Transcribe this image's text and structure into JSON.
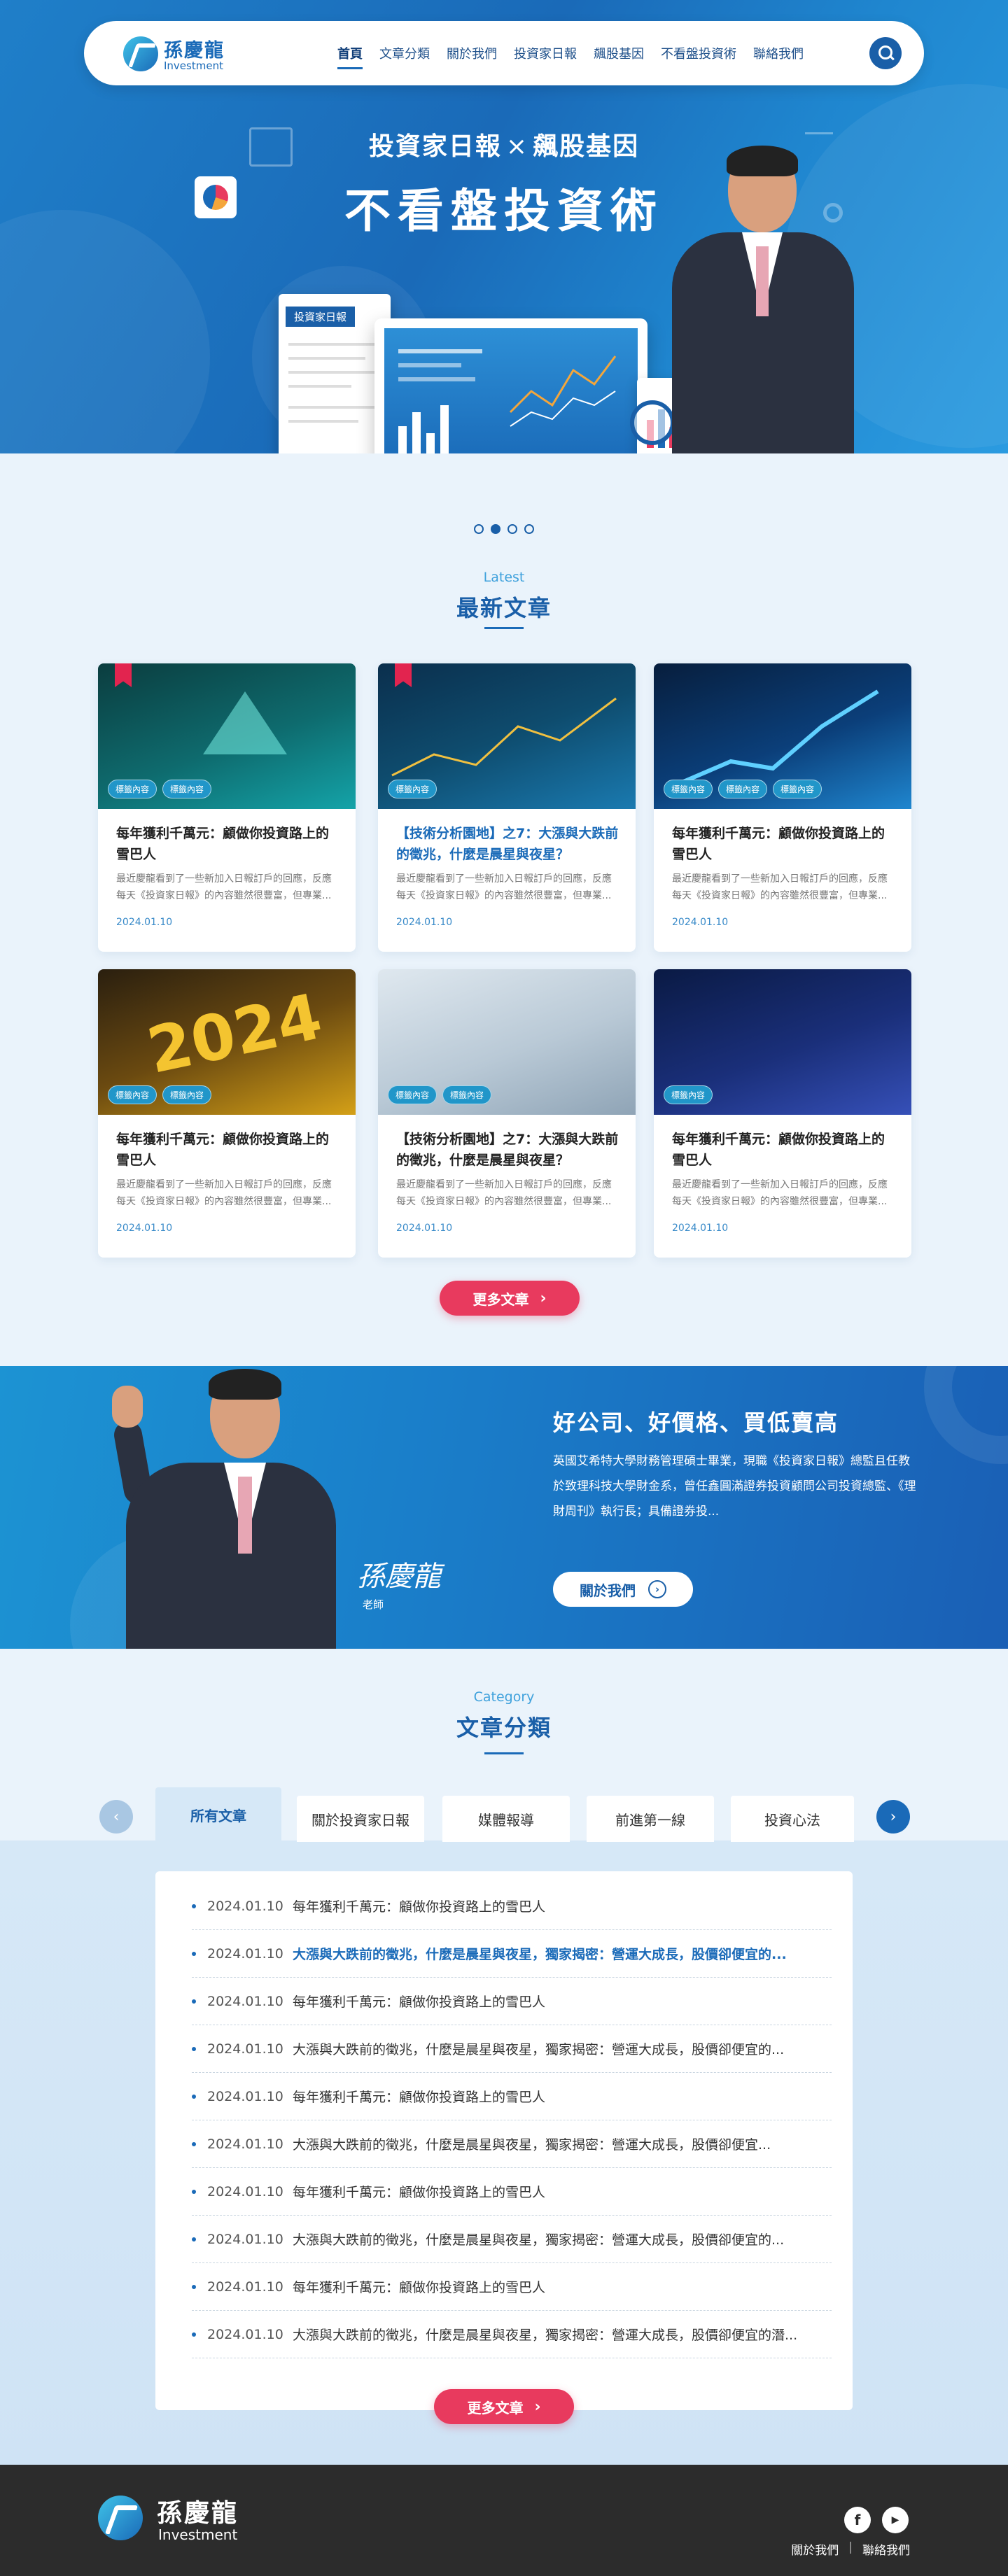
{
  "brand": {
    "name_cn": "孫慶龍",
    "name_en": "Investment"
  },
  "nav": {
    "items": [
      "首頁",
      "文章分類",
      "關於我們",
      "投資家日報",
      "飆股基因",
      "不看盤投資術",
      "聯絡我們"
    ],
    "active": 0
  },
  "hero": {
    "subtitle_left": "投資家日報",
    "subtitle_x": "×",
    "subtitle_right": "飆股基因",
    "title": "不看盤投資術",
    "report_label": "投資家日報",
    "slides": 4,
    "active_slide": 1
  },
  "latest": {
    "en": "Latest",
    "cn": "最新文章",
    "cards": [
      {
        "title": "每年獲利千萬元：顧做你投資路上的雪巴人",
        "desc": "最近慶龍看到了一些新加入日報訂戶的回應，反應每天《投資家日報》的內容雖然很豐富，但專業...",
        "date": "2024.01.10",
        "tags": [
          "標籤內容",
          "標籤內容"
        ],
        "bookmark": true,
        "highlight": false
      },
      {
        "title": "【技術分析園地】之7：大漲與大跌前的徵兆，什麼是晨星與夜星？",
        "desc": "最近慶龍看到了一些新加入日報訂戶的回應，反應每天《投資家日報》的內容雖然很豐富，但專業...",
        "date": "2024.01.10",
        "tags": [
          "標籤內容"
        ],
        "bookmark": true,
        "highlight": true
      },
      {
        "title": "每年獲利千萬元：顧做你投資路上的雪巴人",
        "desc": "最近慶龍看到了一些新加入日報訂戶的回應，反應每天《投資家日報》的內容雖然很豐富，但專業...",
        "date": "2024.01.10",
        "tags": [
          "標籤內容",
          "標籤內容",
          "標籤內容"
        ],
        "bookmark": false,
        "highlight": false
      },
      {
        "title": "每年獲利千萬元：顧做你投資路上的雪巴人",
        "desc": "最近慶龍看到了一些新加入日報訂戶的回應，反應每天《投資家日報》的內容雖然很豐富，但專業...",
        "date": "2024.01.10",
        "tags": [
          "標籤內容",
          "標籤內容"
        ],
        "bookmark": false,
        "highlight": false
      },
      {
        "title": "【技術分析園地】之7：大漲與大跌前的徵兆，什麼是晨星與夜星？",
        "desc": "最近慶龍看到了一些新加入日報訂戶的回應，反應每天《投資家日報》的內容雖然很豐富，但專業...",
        "date": "2024.01.10",
        "tags": [
          "標籤內容",
          "標籤內容"
        ],
        "bookmark": false,
        "highlight": false
      },
      {
        "title": "每年獲利千萬元：顧做你投資路上的雪巴人",
        "desc": "最近慶龍看到了一些新加入日報訂戶的回應，反應每天《投資家日報》的內容雖然很豐富，但專業...",
        "date": "2024.01.10",
        "tags": [
          "標籤內容"
        ],
        "bookmark": false,
        "highlight": false
      }
    ],
    "more": "更多文章"
  },
  "about": {
    "title": "好公司、好價格、買低賣高",
    "desc": "英國艾希特大學財務管理碩士畢業，現職《投資家日報》總監且任教於致理科技大學財金系，曾任鑫圓滿證券投資顧問公司投資總監、《理財周刊》執行長；具備證券投...",
    "signature": "孫慶龍",
    "role": "老師",
    "button": "關於我們"
  },
  "category": {
    "en": "Category",
    "cn": "文章分類",
    "tabs": [
      "所有文章",
      "關於投資家日報",
      "媒體報導",
      "前進第一線",
      "投資心法"
    ],
    "active_tab": 0,
    "list": [
      {
        "date": "2024.01.10",
        "title": "每年獲利千萬元：顧做你投資路上的雪巴人",
        "hl": false
      },
      {
        "date": "2024.01.10",
        "title": "大漲與大跌前的徵兆，什麼是晨星與夜星，獨家揭密：營運大成長，股價卻便宜的...",
        "hl": true
      },
      {
        "date": "2024.01.10",
        "title": "每年獲利千萬元：顧做你投資路上的雪巴人",
        "hl": false
      },
      {
        "date": "2024.01.10",
        "title": "大漲與大跌前的徵兆，什麼是晨星與夜星，獨家揭密：營運大成長，股價卻便宜的...",
        "hl": false
      },
      {
        "date": "2024.01.10",
        "title": "每年獲利千萬元：顧做你投資路上的雪巴人",
        "hl": false
      },
      {
        "date": "2024.01.10",
        "title": "大漲與大跌前的徵兆，什麼是晨星與夜星，獨家揭密：營運大成長，股價卻便宜...",
        "hl": false
      },
      {
        "date": "2024.01.10",
        "title": "每年獲利千萬元：顧做你投資路上的雪巴人",
        "hl": false
      },
      {
        "date": "2024.01.10",
        "title": "大漲與大跌前的徵兆，什麼是晨星與夜星，獨家揭密：營運大成長，股價卻便宜的...",
        "hl": false
      },
      {
        "date": "2024.01.10",
        "title": "每年獲利千萬元：顧做你投資路上的雪巴人",
        "hl": false
      },
      {
        "date": "2024.01.10",
        "title": "大漲與大跌前的徵兆，什麼是晨星與夜星，獨家揭密：營運大成長，股價卻便宜的潛...",
        "hl": false
      }
    ],
    "more": "更多文章"
  },
  "footer": {
    "links": [
      "關於我們",
      "聯絡我們"
    ],
    "social": [
      "facebook-icon",
      "youtube-icon"
    ]
  },
  "colors": {
    "primary": "#1a6ab8",
    "accent": "#e83a5e",
    "footer": "#2c2c2c"
  }
}
